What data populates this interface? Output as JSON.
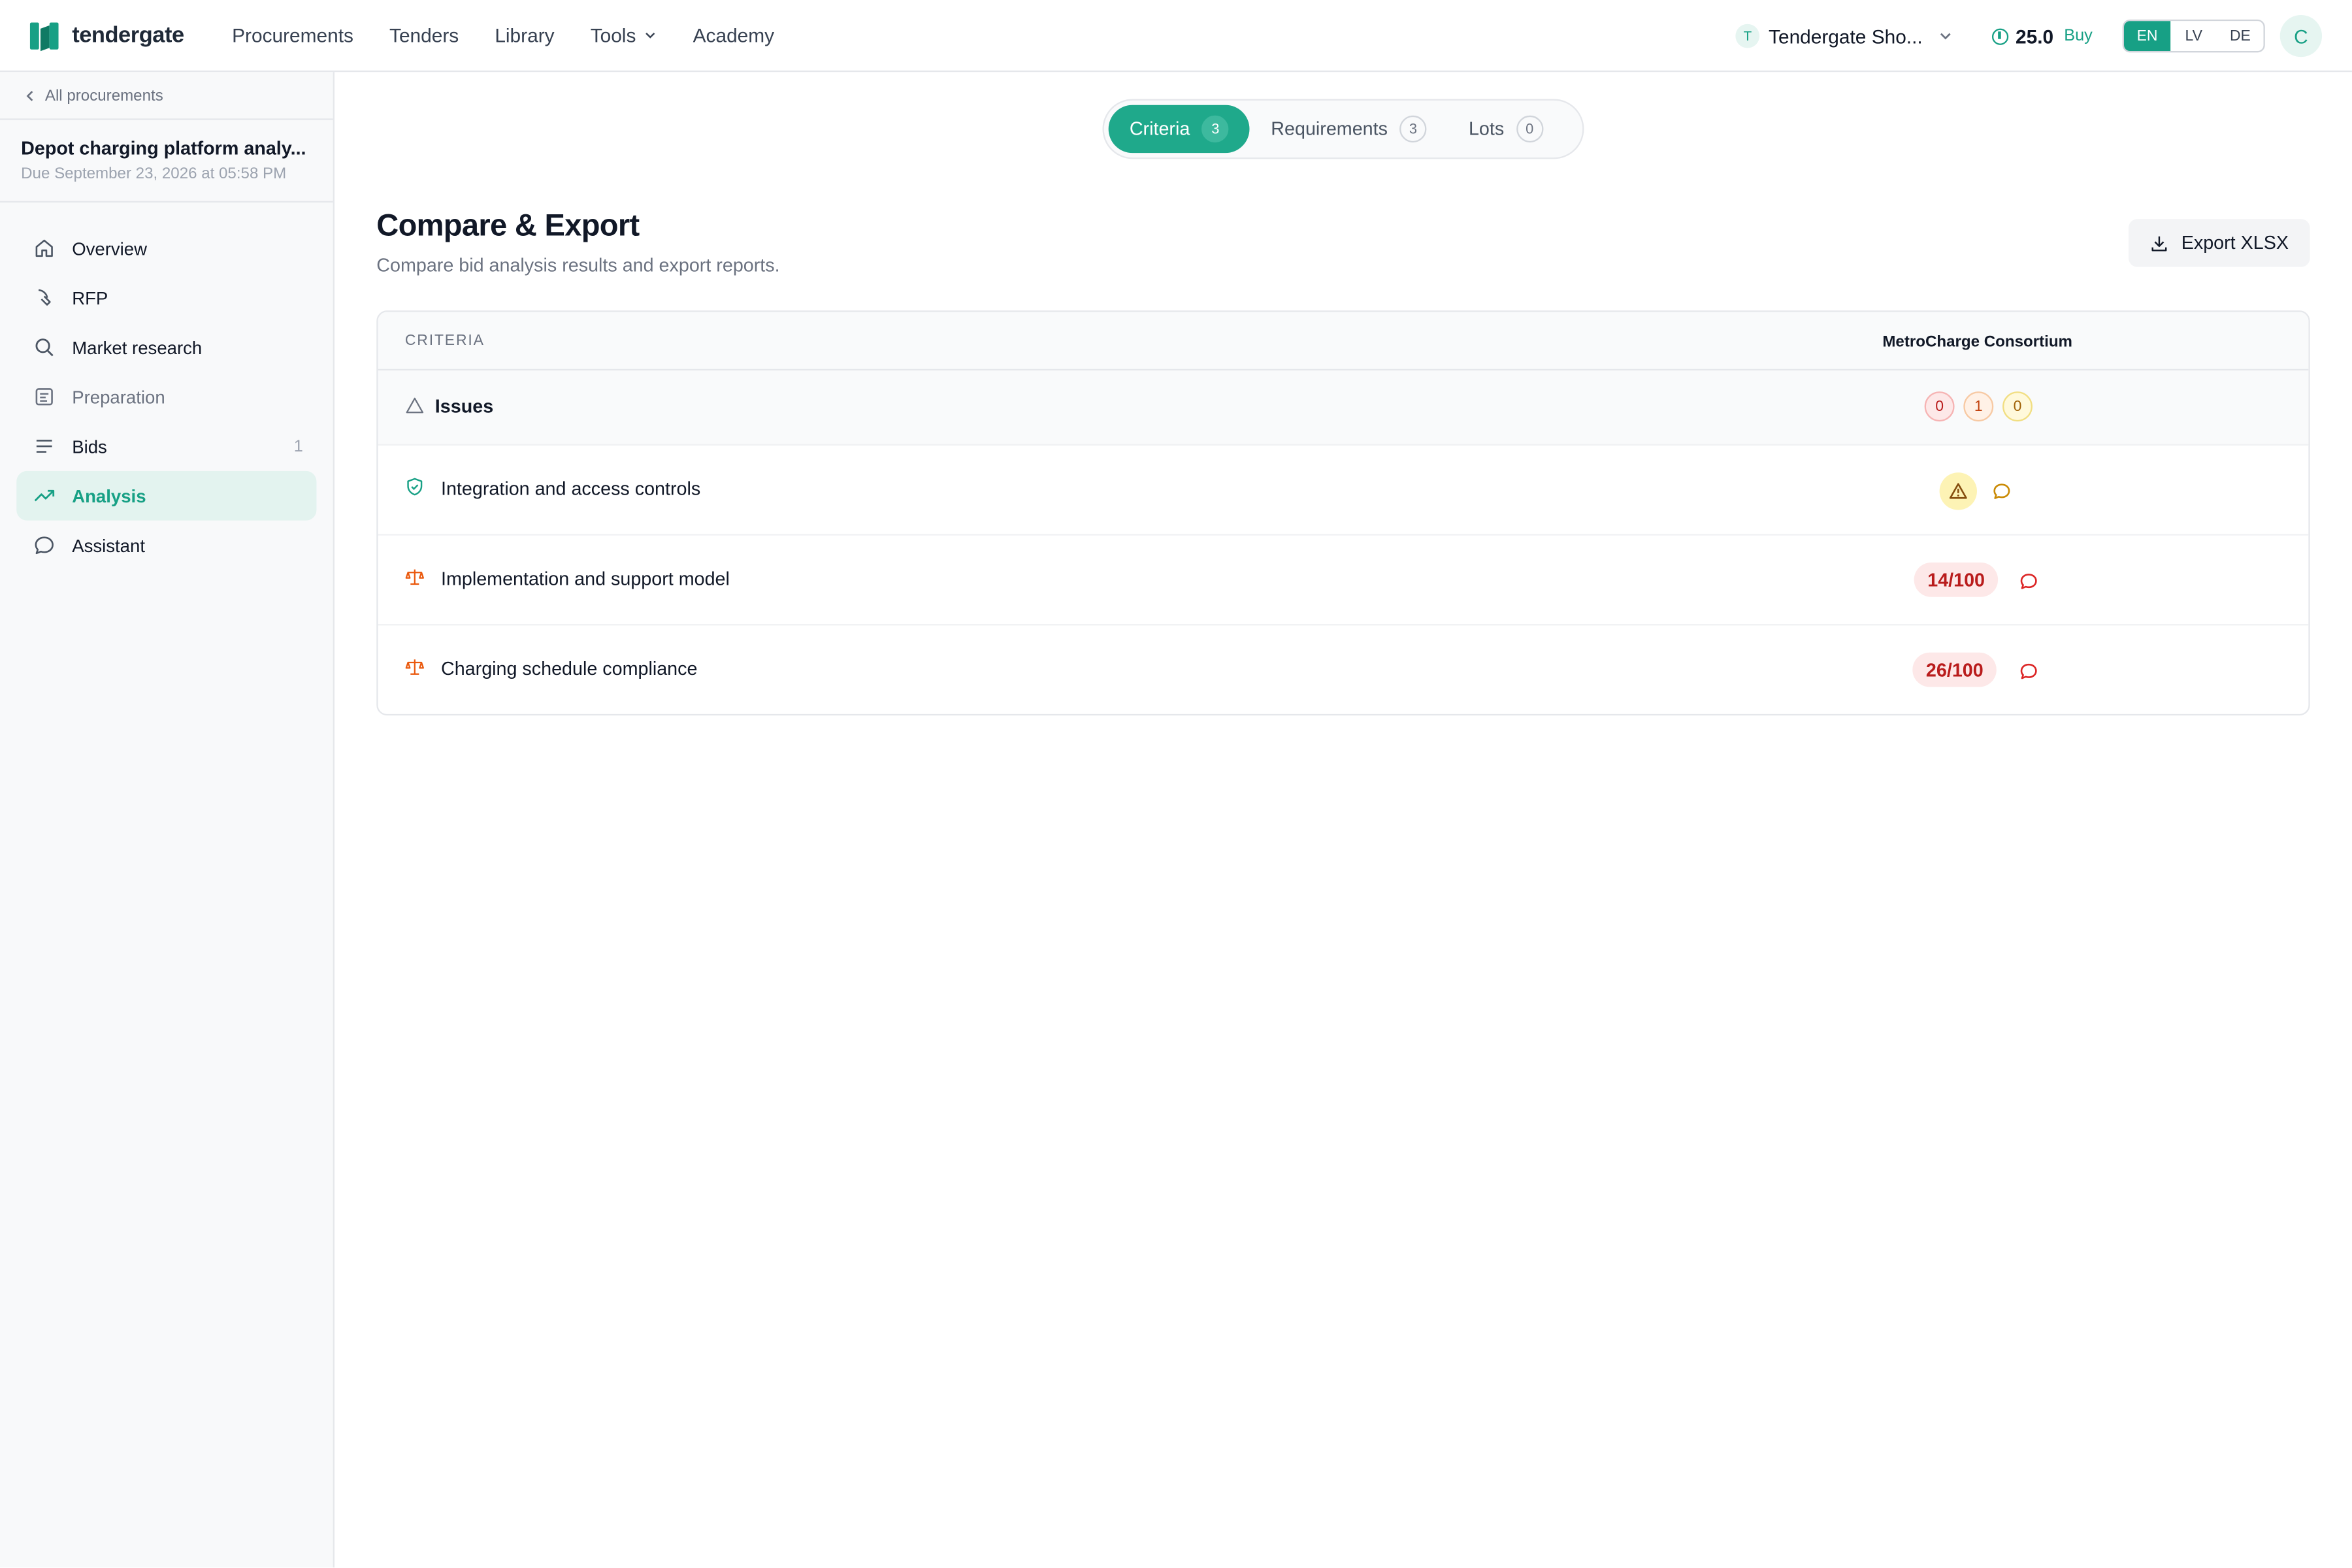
{
  "app": {
    "name": "tendergate",
    "nav": [
      "Procurements",
      "Tenders",
      "Library",
      "Tools",
      "Academy"
    ],
    "org": {
      "badge": "T",
      "name": "Tendergate Sho..."
    },
    "credits": {
      "value": "25.0",
      "buy": "Buy"
    },
    "languages": [
      "EN",
      "LV",
      "DE"
    ],
    "active_language": "EN",
    "avatar": "C"
  },
  "sidebar": {
    "back": "All procurements",
    "project_title": "Depot charging platform analy...",
    "project_due": "Due September 23, 2026 at 05:58 PM",
    "items": [
      {
        "label": "Overview",
        "icon": "home-icon"
      },
      {
        "label": "RFP",
        "icon": "rfp-icon"
      },
      {
        "label": "Market research",
        "icon": "search-icon"
      },
      {
        "label": "Preparation",
        "icon": "preparation-icon"
      },
      {
        "label": "Bids",
        "icon": "list-icon",
        "count": "1"
      },
      {
        "label": "Analysis",
        "icon": "trend-icon",
        "active": true
      },
      {
        "label": "Assistant",
        "icon": "chat-icon"
      }
    ]
  },
  "tabs": [
    {
      "label": "Criteria",
      "count": "3",
      "active": true
    },
    {
      "label": "Requirements",
      "count": "3"
    },
    {
      "label": "Lots",
      "count": "0"
    }
  ],
  "page": {
    "title": "Compare & Export",
    "subtitle": "Compare bid analysis results and export reports.",
    "export_label": "Export XLSX"
  },
  "table": {
    "header_criteria": "CRITERIA",
    "bidder": "MetroCharge Consortium",
    "issues": {
      "label": "Issues",
      "counts": [
        "0",
        "1",
        "0"
      ]
    },
    "rows": [
      {
        "label": "Integration and access controls",
        "icon": "shield-check-icon",
        "result": "warning",
        "comment_color": "#ca8a04"
      },
      {
        "label": "Implementation and support model",
        "icon": "scale-icon",
        "score": "14/100",
        "comment_color": "#dc2626"
      },
      {
        "label": "Charging schedule compliance",
        "icon": "scale-icon",
        "score": "26/100",
        "comment_color": "#dc2626"
      }
    ]
  },
  "colors": {
    "accent": "#17a085",
    "danger": "#b91c1c",
    "warning": "#ca8a04"
  }
}
